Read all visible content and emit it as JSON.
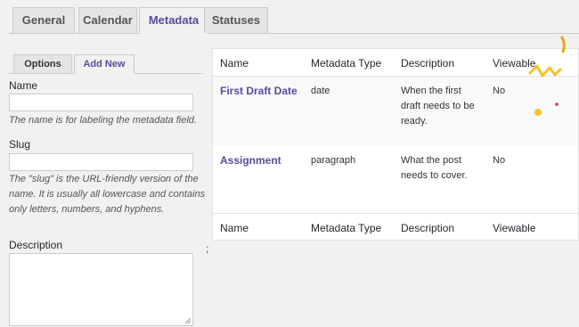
{
  "top_tabs": [
    "General",
    "Calendar",
    "Metadata",
    "Statuses"
  ],
  "sub_tabs": [
    "Options",
    "Add New"
  ],
  "form": {
    "name_label": "Name",
    "name_help": "The name is for labeling the metadata field.",
    "slug_label": "Slug",
    "slug_help": "The \"slug\" is the URL-friendly version of the name. It is usually all lowercase and contains only letters, numbers, and hyphens.",
    "description_label": "Description"
  },
  "separator_text": ";",
  "table": {
    "headers": [
      "Name",
      "Metadata Type",
      "Description",
      "Viewable"
    ],
    "rows": [
      {
        "name": "First Draft Date",
        "type": "date",
        "description": "When the first draft needs to be ready.",
        "viewable": "No"
      },
      {
        "name": "Assignment",
        "type": "paragraph",
        "description": "What the post needs to cover.",
        "viewable": "No"
      }
    ]
  },
  "colors": {
    "accent": "#5b4a9b",
    "deco_yellow": "#f7c325",
    "deco_orange": "#f0a21a",
    "deco_red": "#e3334b"
  }
}
